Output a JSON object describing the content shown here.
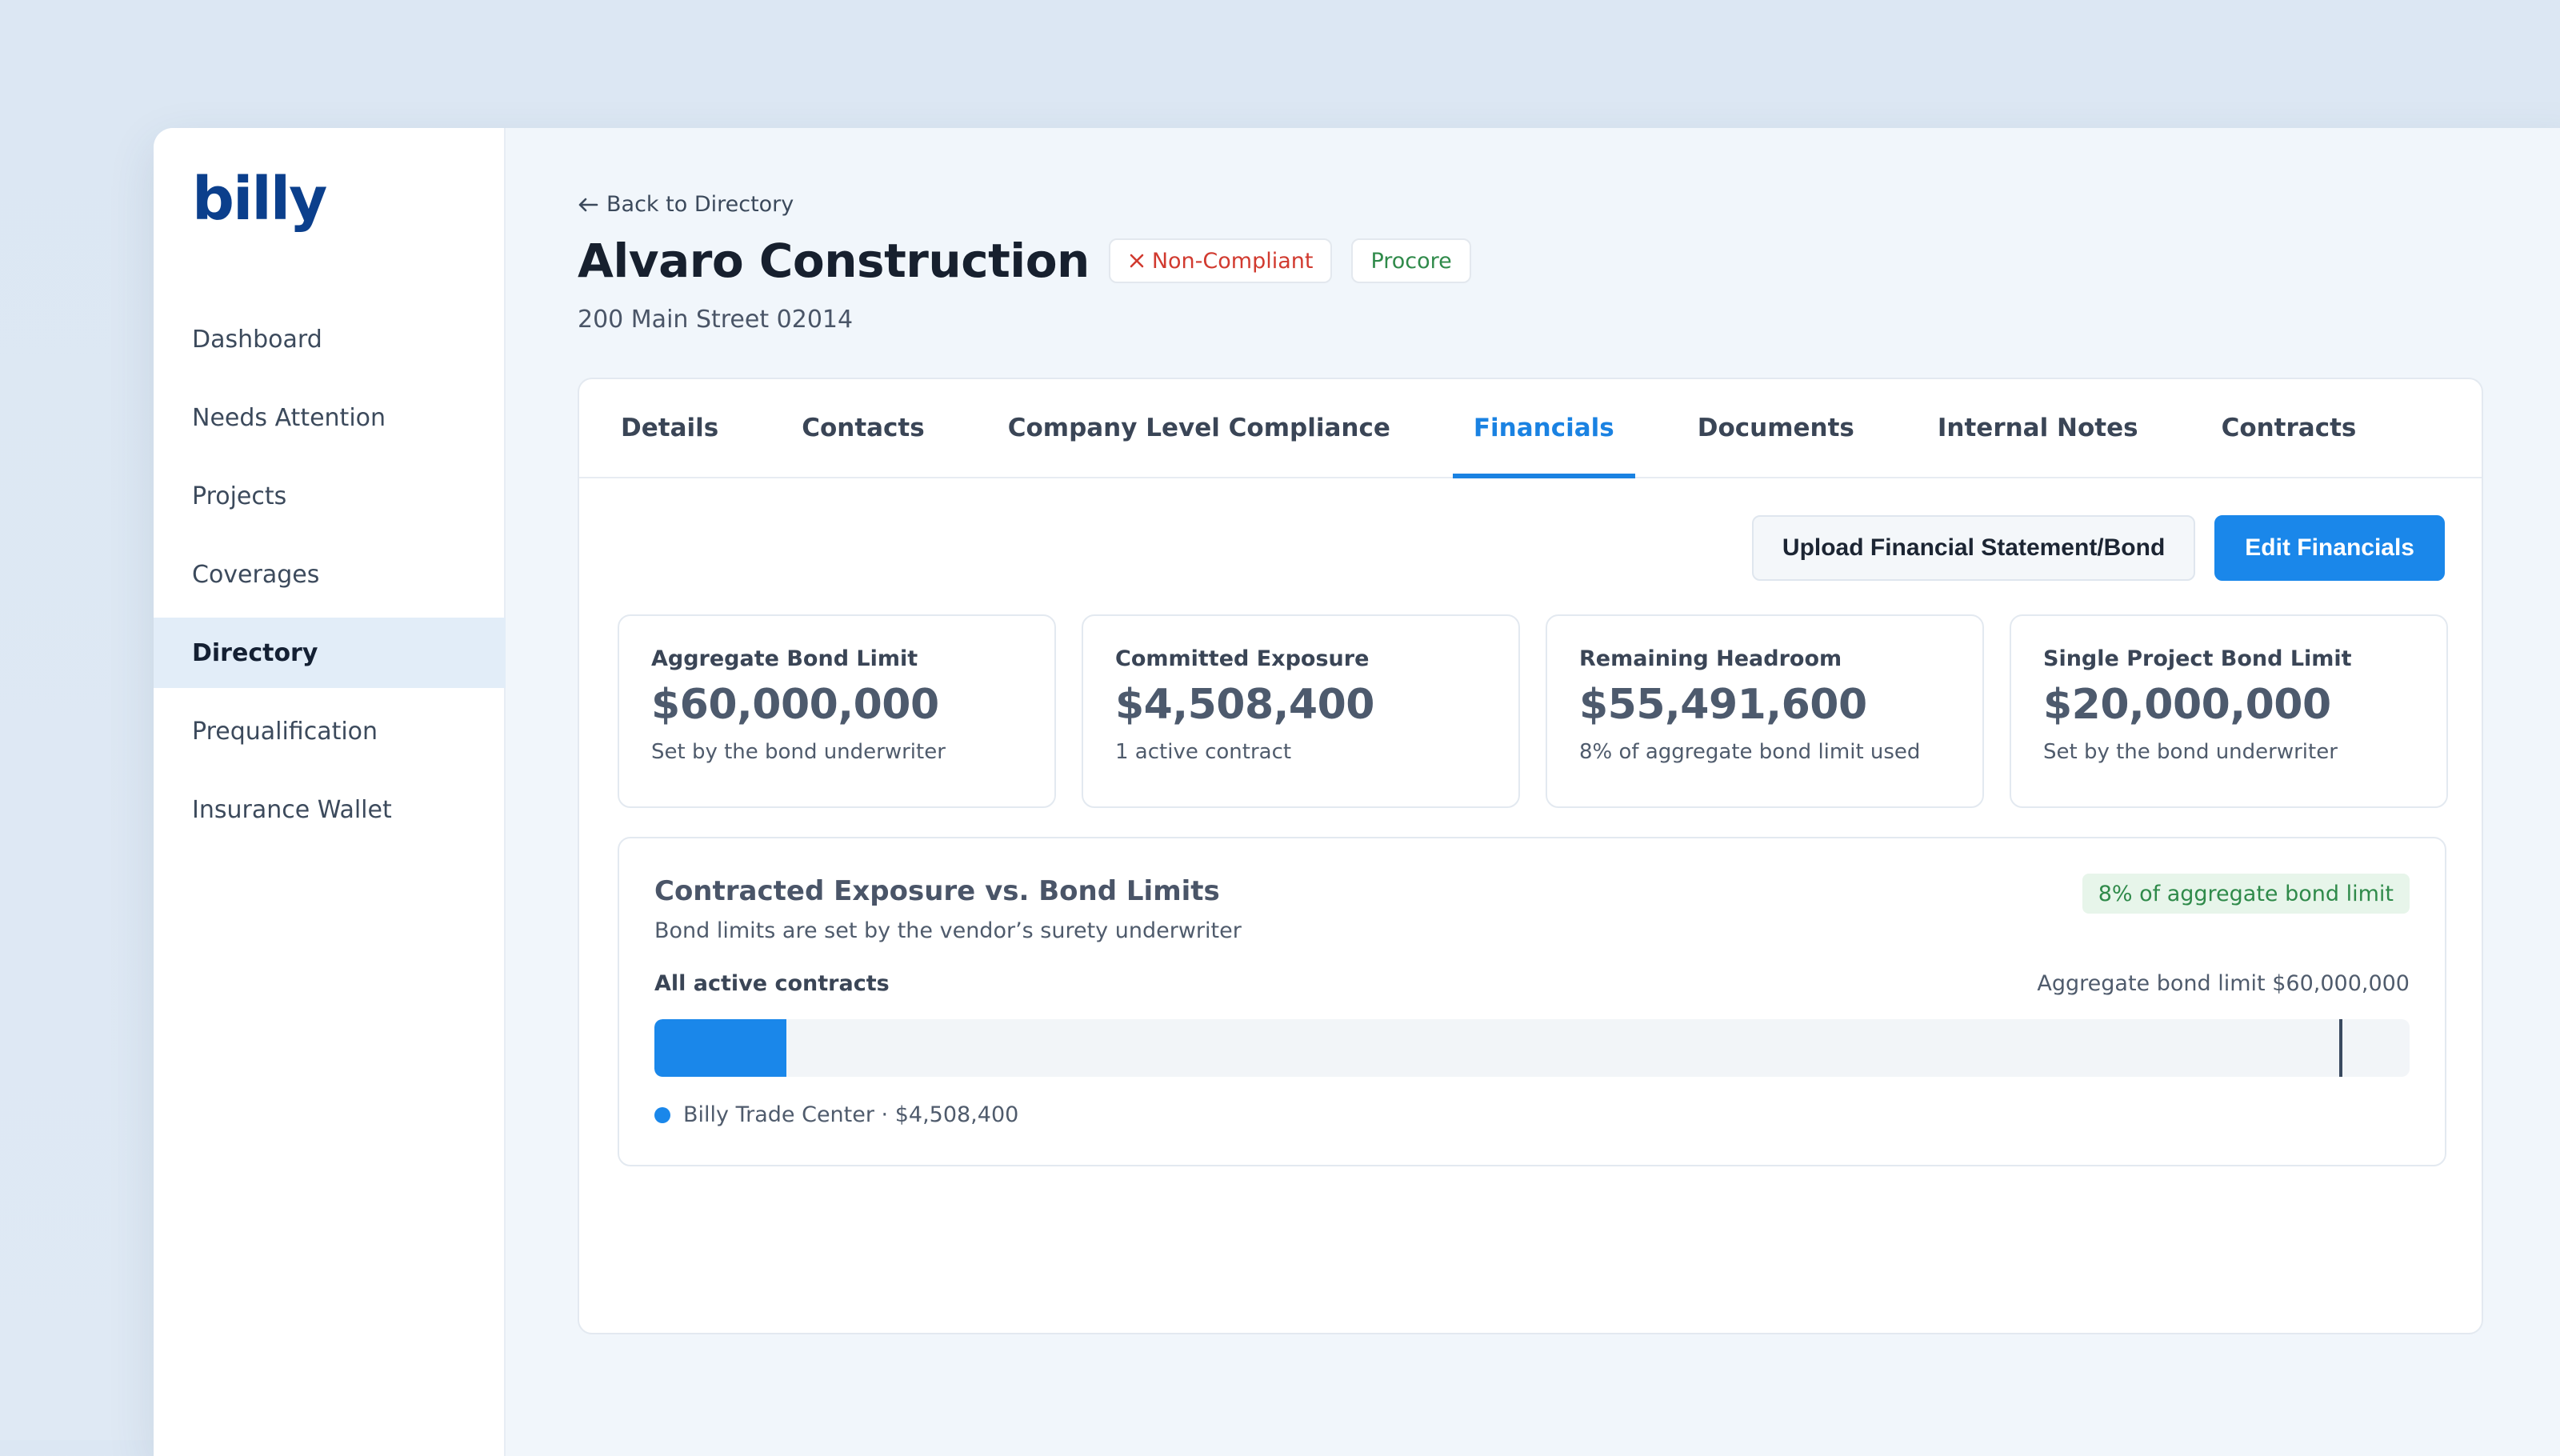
{
  "app": {
    "logo": "billy"
  },
  "sidebar": {
    "items": [
      {
        "label": "Dashboard",
        "active": false
      },
      {
        "label": "Needs Attention",
        "active": false
      },
      {
        "label": "Projects",
        "active": false
      },
      {
        "label": "Coverages",
        "active": false
      },
      {
        "label": "Directory",
        "active": true
      },
      {
        "label": "Prequalification",
        "active": false
      },
      {
        "label": "Insurance Wallet",
        "active": false
      }
    ]
  },
  "header": {
    "back_label": "Back to Directory",
    "back_icon": "arrow-left-icon",
    "company_name": "Alvaro Construction",
    "status_badge": "Non-Compliant",
    "status_icon": "x-icon",
    "source_badge": "Procore",
    "address": "200 Main Street 02014"
  },
  "tabs": [
    {
      "label": "Details",
      "active": false
    },
    {
      "label": "Contacts",
      "active": false
    },
    {
      "label": "Company Level Compliance",
      "active": false
    },
    {
      "label": "Financials",
      "active": true
    },
    {
      "label": "Documents",
      "active": false
    },
    {
      "label": "Internal Notes",
      "active": false
    },
    {
      "label": "Contracts",
      "active": false
    }
  ],
  "actions": {
    "upload_label": "Upload Financial Statement/Bond",
    "edit_label": "Edit Financials"
  },
  "metrics": [
    {
      "label": "Aggregate Bond Limit",
      "value": "$60,000,000",
      "sub": "Set by the bond underwriter"
    },
    {
      "label": "Committed Exposure",
      "value": "$4,508,400",
      "sub": "1 active contract"
    },
    {
      "label": "Remaining Headroom",
      "value": "$55,491,600",
      "sub": "8% of aggregate bond limit used"
    },
    {
      "label": "Single Project Bond Limit",
      "value": "$20,000,000",
      "sub": "Set by the bond underwriter"
    }
  ],
  "exposure": {
    "title": "Contracted Exposure vs. Bond Limits",
    "subtitle": "Bond limits are set by the vendor’s surety underwriter",
    "pill": "8% of aggregate bond limit",
    "left_label": "All active contracts",
    "right_label": "Aggregate bond limit $60,000,000",
    "legend_label": "Billy Trade Center · $4,508,400",
    "used_fraction": 0.075,
    "committed": 4508400,
    "aggregate_limit": 60000000
  },
  "colors": {
    "accent": "#1a87ea",
    "brand": "#0b3f8c",
    "danger": "#d13a2f",
    "success": "#2f8a4a"
  }
}
